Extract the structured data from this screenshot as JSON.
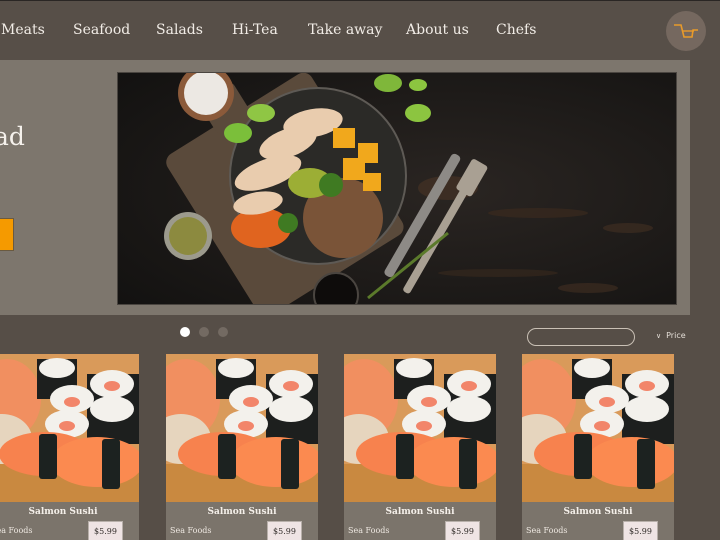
{
  "nav": {
    "items": [
      {
        "label": "Meats"
      },
      {
        "label": "Seafood"
      },
      {
        "label": "Salads"
      },
      {
        "label": "Hi-Tea"
      },
      {
        "label": "Take away"
      },
      {
        "label": "About us"
      },
      {
        "label": "Chefs"
      }
    ],
    "cart_icon": "shopping-cart-icon"
  },
  "hero": {
    "heading_fragment": "ad",
    "image_alt": "Chicken salad bowl with vegetables and buckwheat on dark wooden table",
    "slider": {
      "count": 3,
      "active_index": 0
    }
  },
  "filters": {
    "search_value": "",
    "sort_label": "Price",
    "sort_icon": "chevron-down-icon"
  },
  "colors": {
    "accent": "#f59a00",
    "cart_icon": "#e89a2a",
    "background": "#564e47",
    "panel": "#7d766d"
  },
  "products": [
    {
      "name": "Salmon Sushi",
      "category": "Sea Foods",
      "price": "$5.99"
    },
    {
      "name": "Salmon Sushi",
      "category": "Sea Foods",
      "price": "$5.99"
    },
    {
      "name": "Salmon Sushi",
      "category": "Sea Foods",
      "price": "$5.99"
    },
    {
      "name": "Salmon Sushi",
      "category": "Sea Foods",
      "price": "$5.99"
    }
  ]
}
